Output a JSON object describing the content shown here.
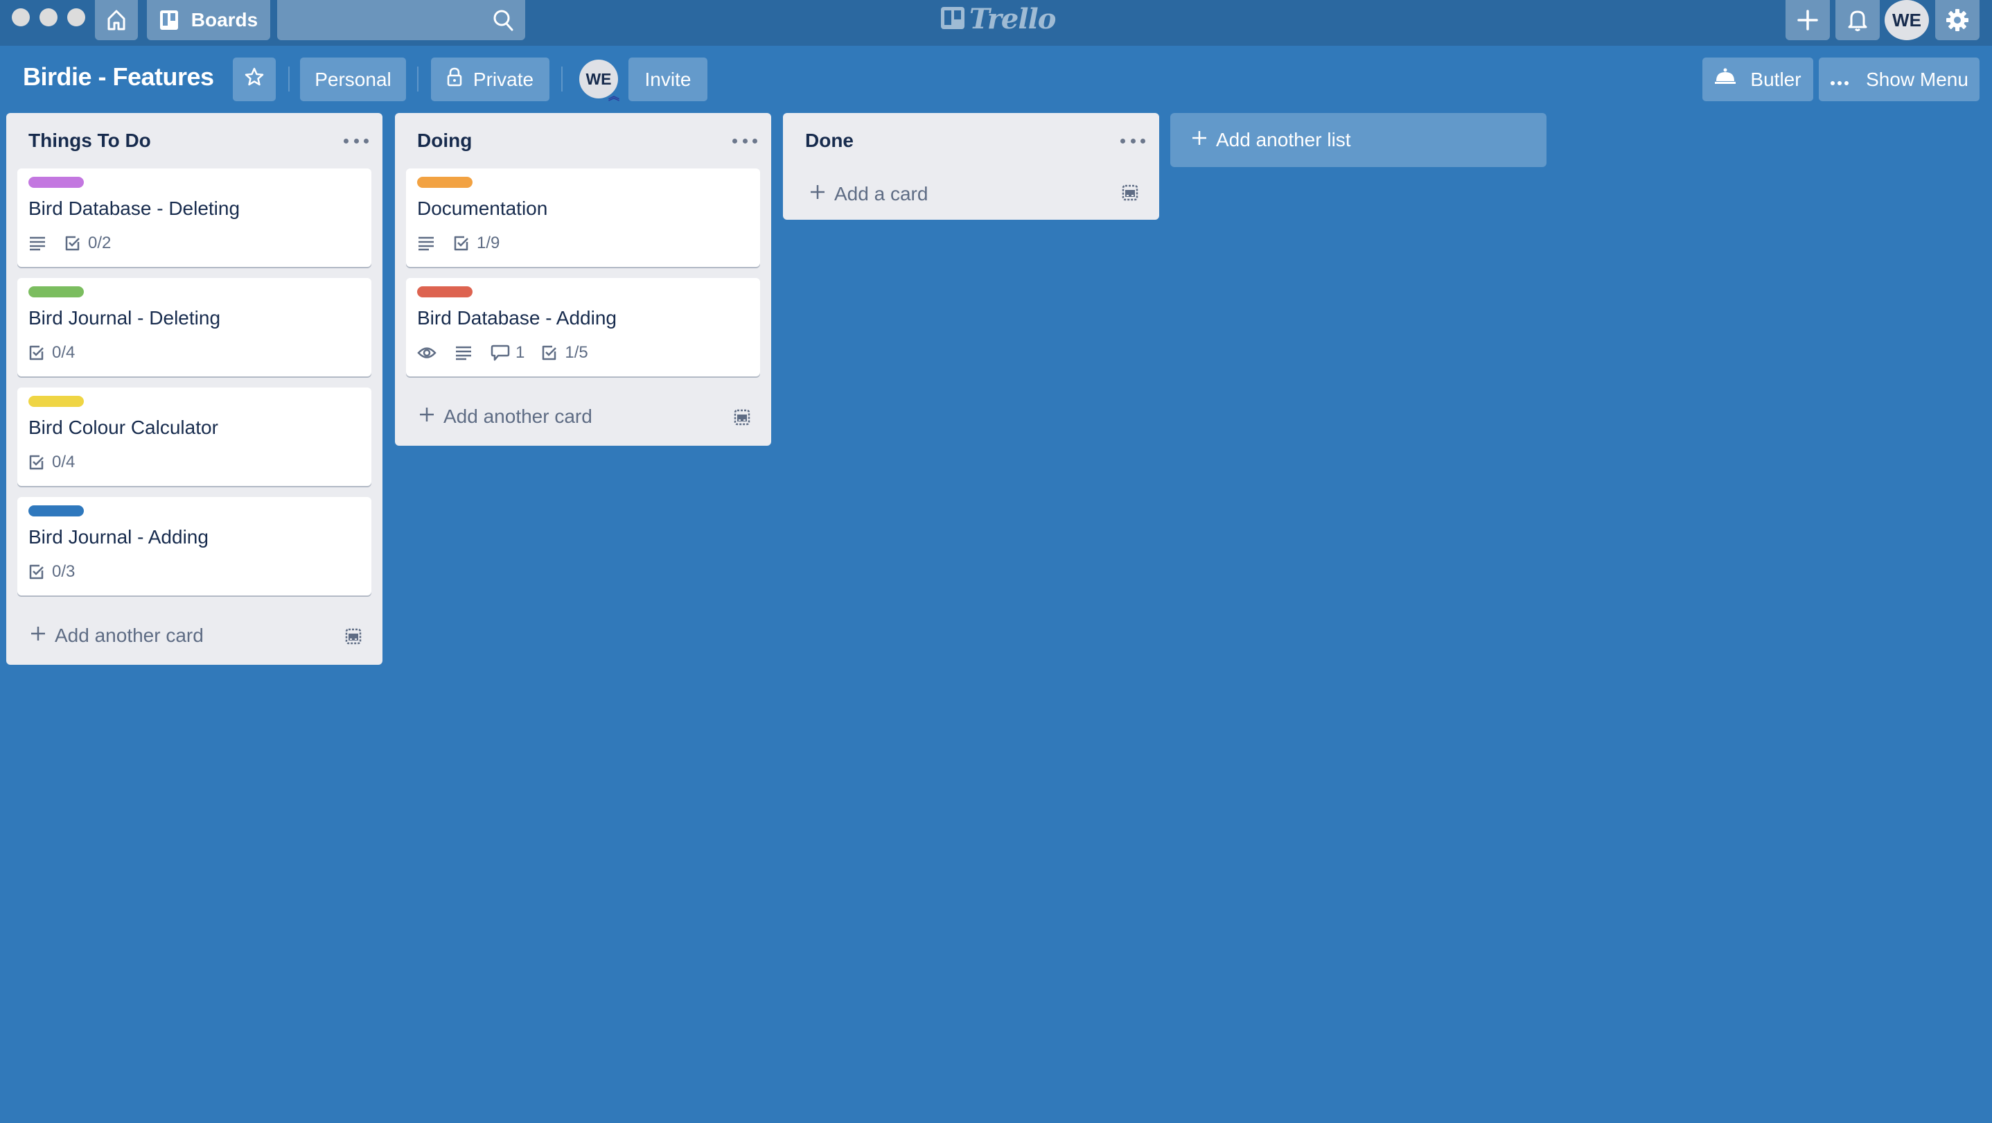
{
  "topbar": {
    "window_controls": [
      "close",
      "minimize",
      "zoom"
    ],
    "home_icon": "home-icon",
    "boards_label": "Boards",
    "search": {
      "value": "",
      "placeholder": ""
    },
    "logo_text": "Trello",
    "create_icon": "plus-icon",
    "notifications_icon": "bell-icon",
    "user_initials": "WE",
    "settings_icon": "gear-icon"
  },
  "board_header": {
    "title": "Birdie - Features",
    "star_icon": "star-icon",
    "team_label": "Personal",
    "visibility_label": "Private",
    "visibility_icon": "lock-icon",
    "member_initials": "WE",
    "admin_badge": "︽",
    "invite_label": "Invite",
    "butler_label": "Butler",
    "butler_icon": "bell-service-icon",
    "show_menu_label": "Show Menu",
    "show_menu_icon": "ellipsis-icon"
  },
  "colors": {
    "board_bg": "#3179ba",
    "topbar_bg": "#2b68a0",
    "list_bg": "#ebecf0",
    "label_purple": "#c377e0",
    "label_green": "#61bd4f",
    "label_yellow": "#f2d600",
    "label_blue": "#0079bf",
    "label_orange": "#ff9f1a",
    "label_red": "#eb5a46"
  },
  "lists": [
    {
      "title": "Things To Do",
      "add_card_label": "Add another card",
      "cards": [
        {
          "title": "Bird Database - Deleting",
          "label_color": "#c377e0",
          "description": true,
          "checklist": "0/2"
        },
        {
          "title": "Bird Journal - Deleting",
          "label_color": "#7bbd5f",
          "checklist": "0/4"
        },
        {
          "title": "Bird Colour Calculator",
          "label_color": "#efd544",
          "checklist": "0/4"
        },
        {
          "title": "Bird Journal - Adding",
          "label_color": "#2f78bd",
          "checklist": "0/3"
        }
      ]
    },
    {
      "title": "Doing",
      "add_card_label": "Add another card",
      "cards": [
        {
          "title": "Documentation",
          "label_color": "#f2a242",
          "description": true,
          "checklist": "1/9"
        },
        {
          "title": "Bird Database - Adding",
          "label_color": "#dd6350",
          "watching": true,
          "description": true,
          "comments": "1",
          "checklist": "1/5"
        }
      ]
    },
    {
      "title": "Done",
      "add_card_label": "Add a card",
      "cards": []
    }
  ],
  "add_list_label": "Add another list"
}
